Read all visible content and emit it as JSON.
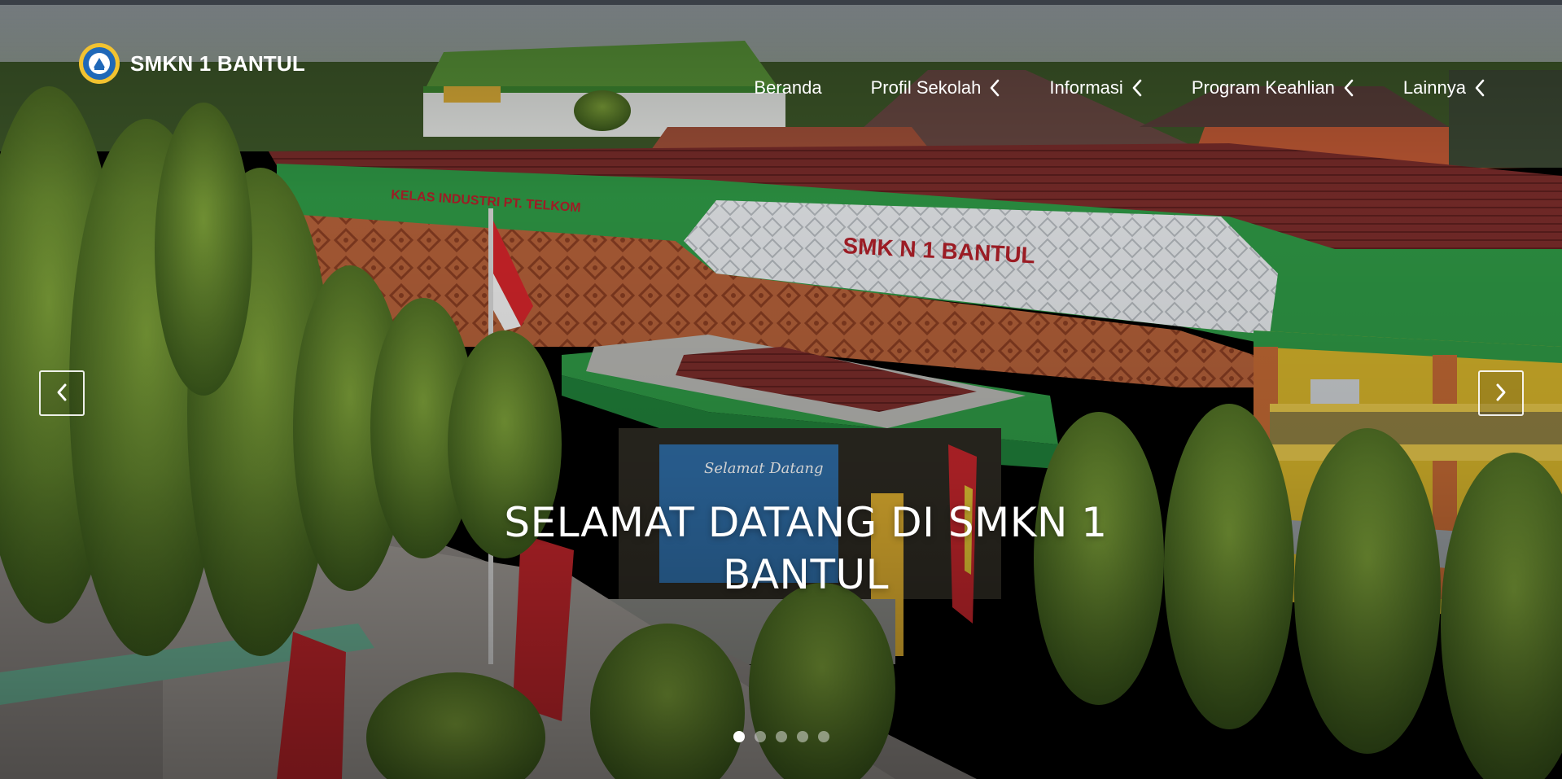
{
  "header": {
    "school_name": "SMKN 1 BANTUL",
    "logo_icon": "school-emblem-icon"
  },
  "nav": {
    "items": [
      {
        "label": "Beranda",
        "has_dropdown": false
      },
      {
        "label": "Profil Sekolah",
        "has_dropdown": true
      },
      {
        "label": "Informasi",
        "has_dropdown": true
      },
      {
        "label": "Program Keahlian",
        "has_dropdown": true
      },
      {
        "label": "Lainnya",
        "has_dropdown": true
      }
    ],
    "dropdown_icon": "chevron-left-icon"
  },
  "hero": {
    "caption": "SELAMAT DATANG DI SMKN 1 BANTUL",
    "building_sign": "SMK N 1 BANTUL",
    "side_sign": "KELAS INDUSTRI PT. TELKOM",
    "banner_text": "Selamat Datang",
    "prev_icon": "chevron-left-icon",
    "next_icon": "chevron-right-icon",
    "slide_count": 5,
    "active_slide": 1
  },
  "colors": {
    "building_green": "#2e9a45",
    "roof_red": "#7a2a2a",
    "wall_yellow": "#d9b52a",
    "facade_orange": "#c46a34",
    "text_white": "#ffffff"
  }
}
